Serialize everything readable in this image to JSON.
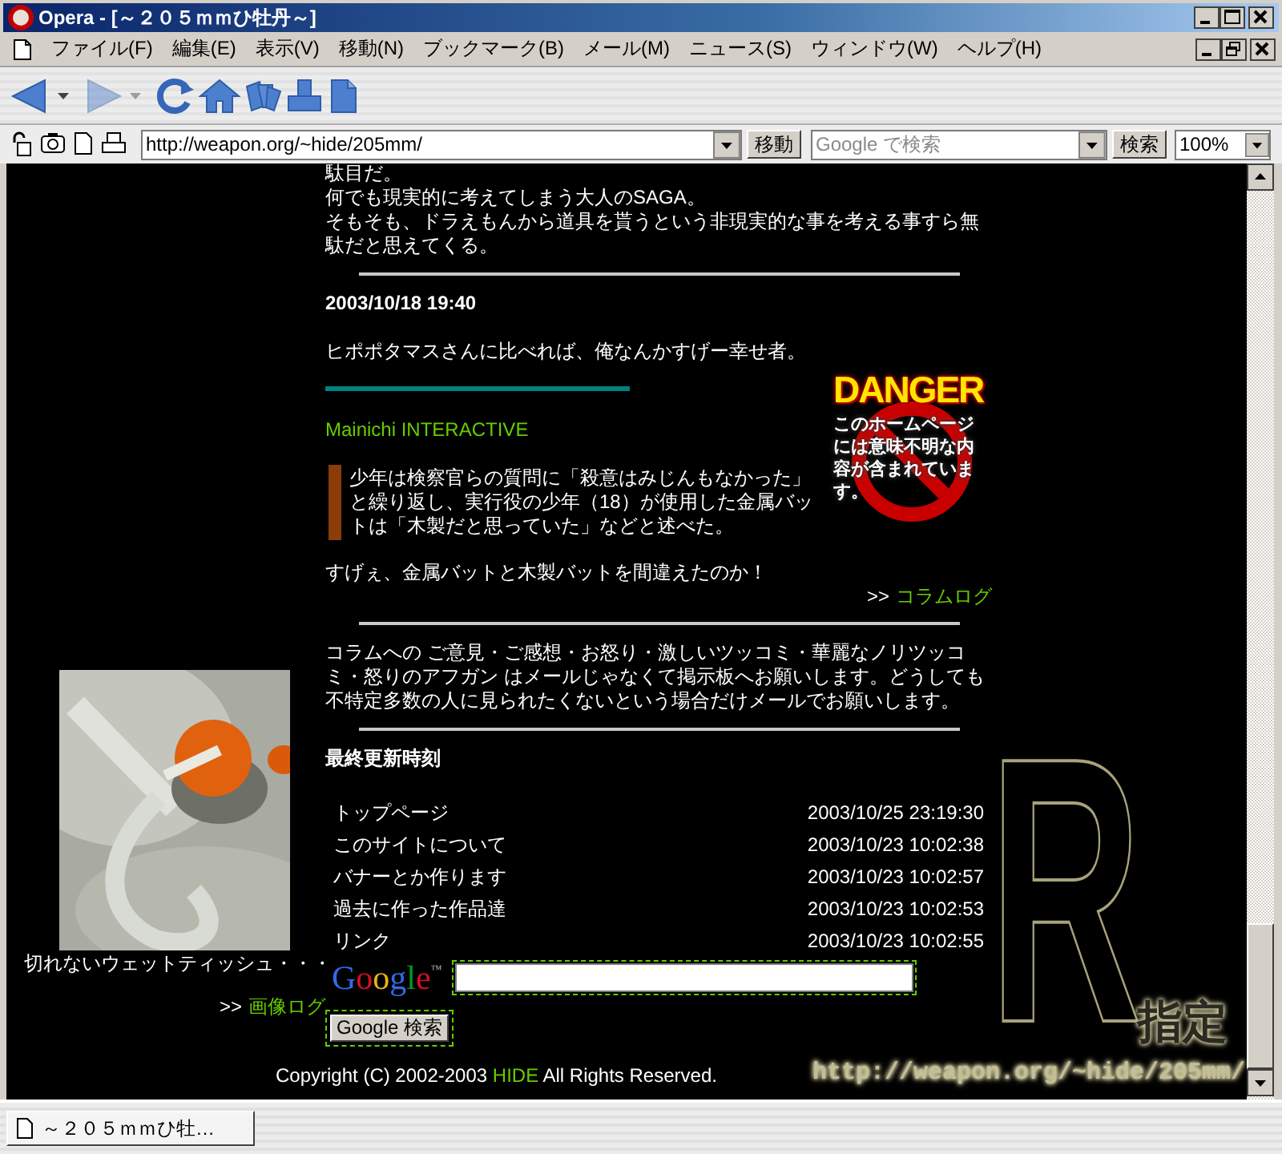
{
  "window": {
    "title": "Opera - [～２０５ｍｍひ牡丹～]"
  },
  "menu": [
    "ファイル(F)",
    "編集(E)",
    "表示(V)",
    "移動(N)",
    "ブックマーク(B)",
    "メール(M)",
    "ニュース(S)",
    "ウィンドウ(W)",
    "ヘルプ(H)"
  ],
  "toolbar": [
    {
      "kind": "back",
      "disabled": false,
      "menu": true
    },
    {
      "kind": "forward",
      "disabled": true,
      "menu": true
    },
    {
      "kind": "reload",
      "disabled": false,
      "menu": false
    },
    {
      "kind": "home",
      "disabled": false,
      "menu": false
    },
    {
      "kind": "hotlist",
      "disabled": false,
      "menu": false
    },
    {
      "kind": "print",
      "disabled": false,
      "menu": false
    },
    {
      "kind": "page",
      "disabled": false,
      "menu": false
    }
  ],
  "address": {
    "url": "http://weapon.org/~hide/205mm/",
    "go": "移動"
  },
  "search": {
    "placeholder": "Google で検索",
    "button": "検索"
  },
  "zoom": {
    "value": "100%"
  },
  "page": {
    "intro": [
      "駄目だ。",
      "何でも現実的に考えてしまう大人のSAGA。",
      "そもそも、ドラえもんから道具を貰うという非現実的な事を考える事すら無駄だと思えてくる。"
    ],
    "entry": {
      "date": "2003/10/18 19:40",
      "text": "ヒポポタマスさんに比べれば、俺なんかすげー幸せ者。",
      "source": "Mainichi INTERACTIVE",
      "quote": "少年は検察官らの質問に「殺意はみじんもなかった」と繰り返し、実行役の少年（18）が使用した金属バットは「木製だと思っていた」などと述べた。",
      "comment": "すげぇ、金属バットと木製バットを間違えたのか！"
    },
    "column_log": {
      "prefix": ">>",
      "link": "コラムログ"
    },
    "notice": "コラムへの ご意見・ご感想・お怒り・激しいツッコミ・華麗なノリツッコミ・怒りのアフガン はメールじゃなくて掲示板へお願いします。どうしても不特定多数の人に見られたくないという場合だけメールでお願いします。",
    "updates": {
      "title": "最終更新時刻",
      "rows": [
        {
          "page": "トップページ",
          "time": "2003/10/25 23:19:30"
        },
        {
          "page": "このサイトについて",
          "time": "2003/10/23 10:02:38"
        },
        {
          "page": "バナーとか作ります",
          "time": "2003/10/23 10:02:57"
        },
        {
          "page": "過去に作った作品達",
          "time": "2003/10/23 10:02:53"
        },
        {
          "page": "リンク",
          "time": "2003/10/23 10:02:55"
        }
      ]
    },
    "google": {
      "logo": "Google",
      "tm": "™",
      "button": "Google 検索"
    },
    "copyright": {
      "before": "Copyright (C) 2002-2003 ",
      "link": "HIDE",
      "after": " All Rights Reserved."
    },
    "photo": {
      "kind": "picture",
      "caption": "切れないウェットティッシュ・・・"
    },
    "image_log": {
      "prefix": ">>",
      "link": "画像ログ"
    },
    "danger": {
      "title": "DANGER",
      "message": "このホームページには意味不明な内容が含まれています。"
    },
    "rating": {
      "letter": "R",
      "label": "指定",
      "url": "http://weapon.org/~hide/205mm/"
    }
  },
  "tabs": [
    {
      "label": "～２０５ｍｍひ牡…",
      "selected": true
    }
  ]
}
